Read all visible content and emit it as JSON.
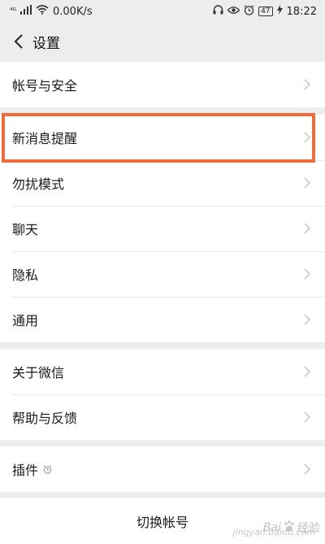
{
  "status_bar": {
    "signal": "⁴ᴳ",
    "speed": "0.00K/s",
    "battery": "47",
    "time": "18:22"
  },
  "nav": {
    "title": "设置"
  },
  "groups": [
    {
      "items": [
        {
          "label": "帐号与安全"
        }
      ]
    },
    {
      "items": [
        {
          "label": "新消息提醒"
        },
        {
          "label": "勿扰模式"
        },
        {
          "label": "聊天"
        },
        {
          "label": "隐私"
        },
        {
          "label": "通用"
        }
      ]
    },
    {
      "items": [
        {
          "label": "关于微信"
        },
        {
          "label": "帮助与反馈"
        }
      ]
    },
    {
      "items": [
        {
          "label": "插件",
          "icon": "alarm-clock-icon"
        }
      ]
    }
  ],
  "switch_account": "切换帐号",
  "watermark": {
    "logo_text": "Bai",
    "word": "经验",
    "sub": "jingyan.baidu.com"
  },
  "colors": {
    "highlight_border": "#f36b3a",
    "background": "#ededed"
  }
}
